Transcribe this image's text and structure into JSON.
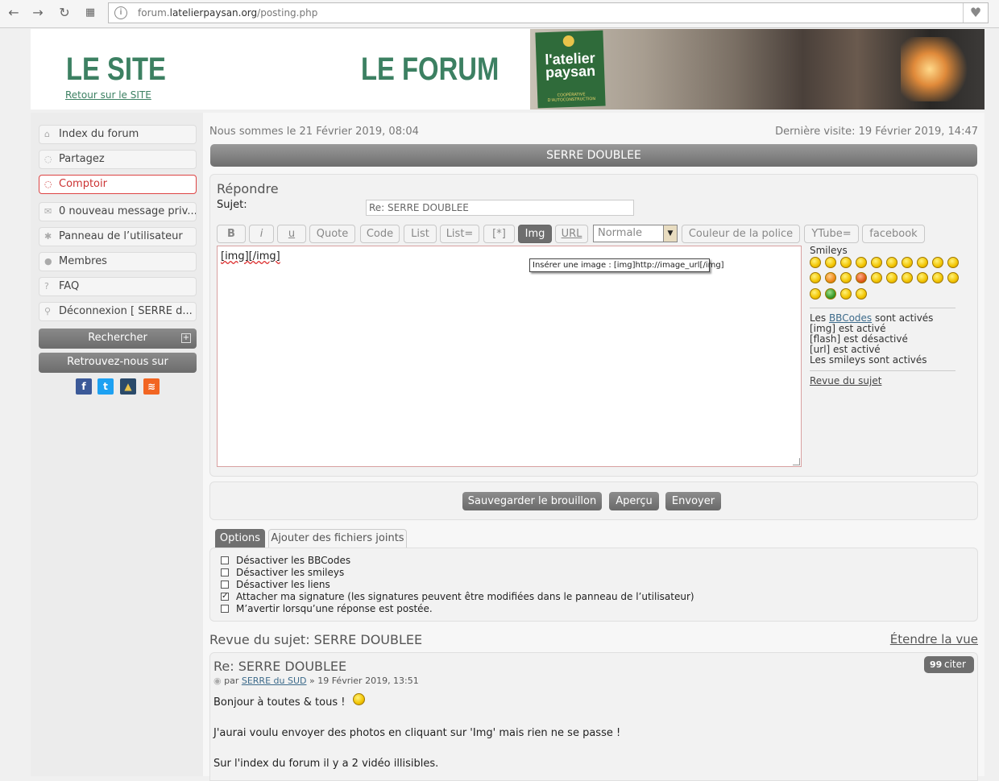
{
  "browser": {
    "url_prefix": "forum.",
    "url_domain": "latelierpaysan.org",
    "url_path": "/posting.php",
    "info_icon": "i",
    "heart_icon": "♥"
  },
  "header": {
    "site_title": "LE SITE",
    "site_link": "Retour sur le SITE",
    "forum_title": "LE FORUM",
    "logo_line1": "l'atelier",
    "logo_line2": "paysan",
    "logo_sub": "COOPÉRATIVE D'AUTOCONSTRUCTION"
  },
  "sidebar": {
    "items": [
      {
        "label": "Index du forum",
        "icon": "⌂"
      },
      {
        "label": "Partagez",
        "icon": "◌"
      },
      {
        "label": "Comptoir",
        "icon": "◌"
      },
      {
        "label": "0 nouveau message priv...",
        "icon": "✉"
      },
      {
        "label": "Panneau de l’utilisateur",
        "icon": "✱"
      },
      {
        "label": "Membres",
        "icon": "●"
      },
      {
        "label": "FAQ",
        "icon": "?"
      },
      {
        "label": "Déconnexion [ SERRE d...",
        "icon": "⚲"
      }
    ],
    "search_label": "Rechercher",
    "search_expand_icon": "+",
    "follow_label": "Retrouvez-nous sur",
    "social": [
      "f",
      "t",
      "▲",
      "≋"
    ]
  },
  "topbar": {
    "current_date": "Nous sommes le 21 Février 2019, 08:04",
    "last_visit": "Dernière visite: 19 Février 2019, 14:47"
  },
  "topic_title": "SERRE DOUBLEE",
  "reply": {
    "heading": "Répondre",
    "subject_label": "Sujet:",
    "subject_value": "Re: SERRE DOUBLEE",
    "toolbar": {
      "bold": "B",
      "italic": "i",
      "underline": "u",
      "quote": "Quote",
      "code": "Code",
      "list": "List",
      "list_eq": "List=",
      "item": "[*]",
      "img": "Img",
      "url": "URL",
      "size_value": "Normale",
      "color": "Couleur de la police",
      "youtube": "YTube=",
      "facebook": "facebook"
    },
    "message_text": "[img][/img]",
    "tooltip": "Insérer une image : [img]http://image_url[/img]",
    "smileys_label": "Smileys",
    "bbcode_pre": "Les ",
    "bbcode_link": "BBCodes",
    "bbcode_post": " sont activés",
    "img_status": "[img] est activé",
    "flash_status": "[flash] est désactivé",
    "url_status": "[url] est activé",
    "smileys_status": "Les smileys sont activés",
    "topic_review_link": "Revue du sujet"
  },
  "actions": {
    "save_draft": "Sauvegarder le brouillon",
    "preview": "Aperçu",
    "submit": "Envoyer"
  },
  "options": {
    "tab_options": "Options",
    "tab_attachments": "Ajouter des fichiers joints",
    "checkboxes": [
      {
        "label": "Désactiver les BBCodes",
        "checked": false
      },
      {
        "label": "Désactiver les smileys",
        "checked": false
      },
      {
        "label": "Désactiver les liens",
        "checked": false
      },
      {
        "label": "Attacher ma signature (les signatures peuvent être modifiées dans le panneau de l’utilisateur)",
        "checked": true
      },
      {
        "label": "M’avertir lorsqu’une réponse est postée.",
        "checked": false
      }
    ]
  },
  "review": {
    "heading": "Revue du sujet: SERRE DOUBLEE",
    "expand_link": "Étendre la vue",
    "post_title": "Re: SERRE DOUBLEE",
    "by": "par",
    "author": "SERRE du SUD",
    "date": "» 19 Février 2019, 13:51",
    "quote_button": "citer",
    "quote_icon": "99",
    "lines": [
      "Bonjour à toutes & tous !",
      "J'aurai voulu envoyer des photos en cliquant sur 'Img' mais rien ne se passe !",
      "Sur l'index du forum il y a 2 vidéo illisibles."
    ]
  },
  "colors": {
    "brand_green": "#3c8062",
    "button_gray": "#6e6e6e",
    "active_red": "#cc3333"
  }
}
